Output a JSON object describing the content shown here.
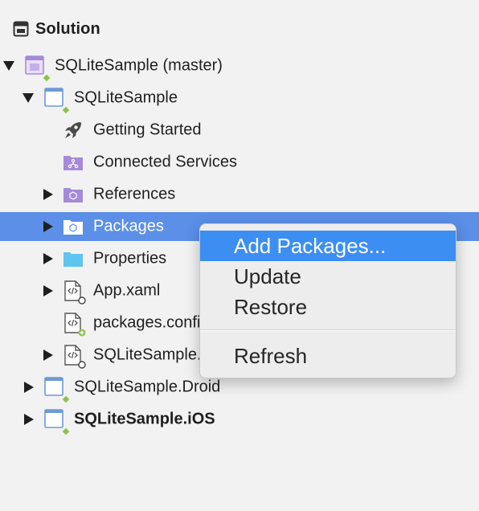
{
  "header": {
    "title": "Solution",
    "icon": "solution-window-icon"
  },
  "tree": {
    "rows": [
      {
        "label": "SQLiteSample (master)",
        "icon": "solution-icon",
        "expanded": true
      },
      {
        "label": "SQLiteSample",
        "icon": "project-icon",
        "expanded": true
      },
      {
        "label": "Getting Started",
        "icon": "rocket-icon"
      },
      {
        "label": "Connected Services",
        "icon": "connected-services-folder-icon"
      },
      {
        "label": "References",
        "icon": "references-folder-icon",
        "expanded": false
      },
      {
        "label": "Packages",
        "icon": "packages-folder-icon",
        "expanded": false,
        "selected": true
      },
      {
        "label": "Properties",
        "icon": "folder-icon",
        "expanded": false
      },
      {
        "label": "App.xaml",
        "icon": "xaml-file-icon",
        "expanded": false
      },
      {
        "label": "packages.config",
        "icon": "config-file-icon"
      },
      {
        "label": "SQLiteSample.xaml",
        "icon": "xaml-file-icon",
        "expanded": false
      },
      {
        "label": "SQLiteSample.Droid",
        "icon": "project-icon",
        "expanded": false
      },
      {
        "label": "SQLiteSample.iOS",
        "icon": "project-icon",
        "expanded": false,
        "bold": true
      }
    ]
  },
  "context_menu": {
    "items": [
      {
        "label": "Add Packages...",
        "active": true
      },
      {
        "label": "Update"
      },
      {
        "label": "Restore"
      },
      {
        "label": "Refresh"
      }
    ]
  },
  "colors": {
    "selection": "#5b8fe8",
    "menu_highlight": "#3c8ef2",
    "folder_blue": "#5ec4f0",
    "folder_purple": "#a48ad8",
    "project_border": "#6c9ad6",
    "green_dot": "#8bc34a"
  }
}
